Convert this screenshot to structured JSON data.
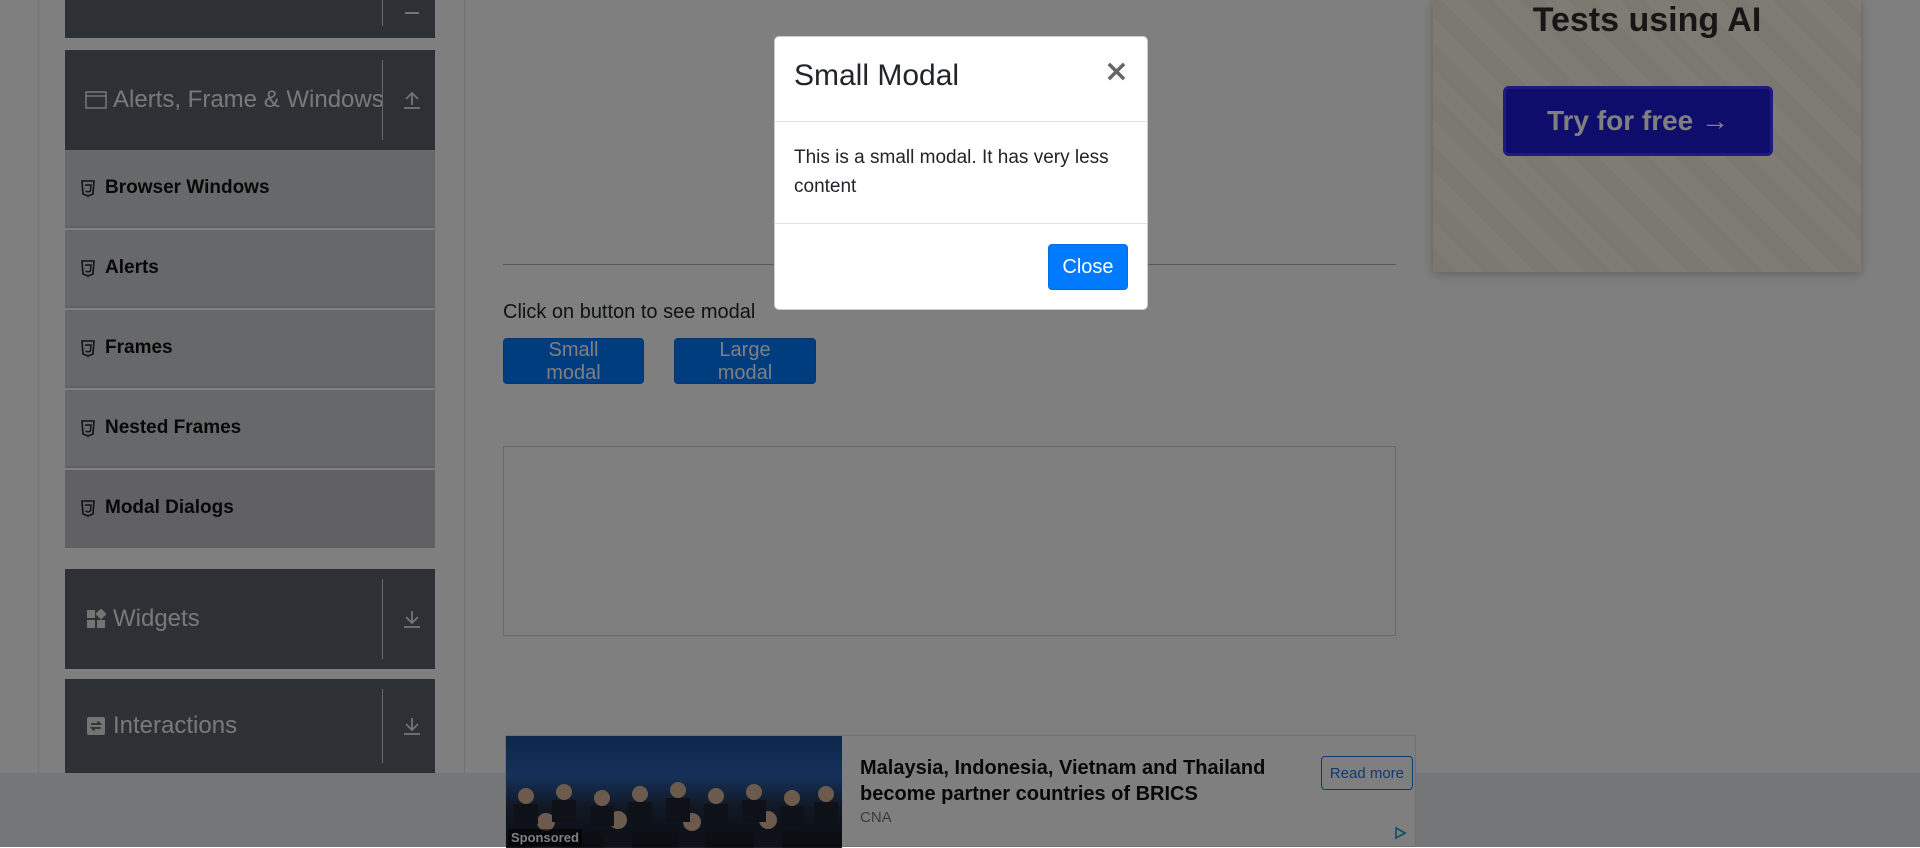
{
  "sidebar": {
    "groups": [
      {
        "label": "",
        "icon": "upload-arrow-icon"
      },
      {
        "label": "Alerts, Frame & Windows",
        "icon": "window-icon",
        "toggle_icon": "upload-arrow-icon"
      },
      {
        "label": "Widgets",
        "icon": "widgets-grid-icon",
        "toggle_icon": "download-arrow-icon"
      },
      {
        "label": "Interactions",
        "icon": "interactions-icon",
        "toggle_icon": "download-arrow-icon"
      }
    ],
    "items": [
      {
        "label": "Browser Windows"
      },
      {
        "label": "Alerts"
      },
      {
        "label": "Frames"
      },
      {
        "label": "Nested Frames"
      },
      {
        "label": "Modal Dialogs"
      }
    ]
  },
  "main": {
    "instructions": "Click on button to see modal",
    "small_modal_button": "Small modal",
    "large_modal_button": "Large modal"
  },
  "side_ad": {
    "heading": "Tests using AI",
    "cta": "Try for free →"
  },
  "bottom_ad": {
    "headline": "Malaysia, Indonesia, Vietnam and Thailand become partner countries of BRICS",
    "source": "CNA",
    "read_more": "Read more",
    "sponsored": "Sponsored"
  },
  "modal": {
    "title": "Small Modal",
    "close_symbol": "×",
    "body": "This is a small modal. It has very less content",
    "close_button": "Close"
  },
  "colors": {
    "primary": "#007bff",
    "sidebar_group": "#5a6169",
    "sidebar_item": "#cfd0d2",
    "ad_cta": "#1f1ad6"
  }
}
